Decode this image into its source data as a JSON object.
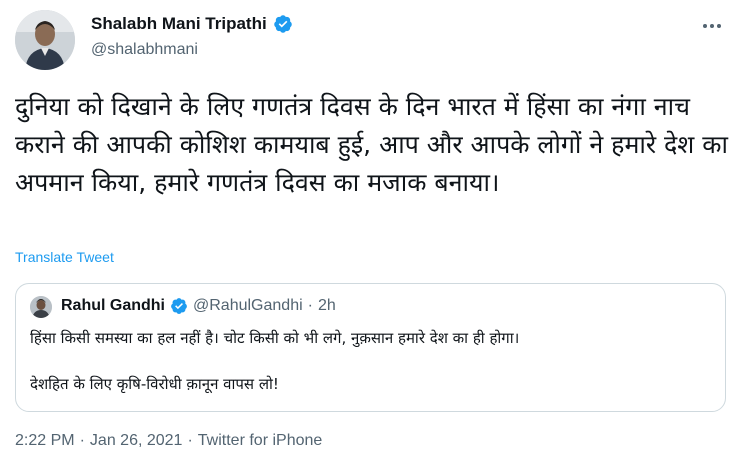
{
  "author": {
    "name": "Shalabh Mani Tripathi",
    "handle": "@shalabhmani",
    "verified": true
  },
  "tweet": {
    "text": "दुनिया को दिखाने के लिए गणतंत्र दिवस के दिन भारत में हिंसा का नंगा नाच कराने की आपकी कोशिश कामयाब हुई, आप और आपके लोगों ने हमारे देश का अपमान किया, हमारे गणतंत्र दिवस का मजाक बनाया।",
    "translate_label": "Translate Tweet"
  },
  "quoted_tweet": {
    "name": "Rahul Gandhi",
    "handle": "@RahulGandhi",
    "separator": "·",
    "time": "2h",
    "verified": true,
    "text_line1": "हिंसा किसी समस्या का हल नहीं है। चोट किसी को भी लगे, नुक़सान हमारे देश का ही होगा।",
    "text_line2": "देशहित के लिए कृषि-विरोधी क़ानून वापस लो!"
  },
  "meta": {
    "time": "2:22 PM",
    "sep1": "·",
    "date": "Jan 26, 2021",
    "sep2": "·",
    "source": "Twitter for iPhone"
  },
  "colors": {
    "accent": "#1d9bf0",
    "secondary_text": "#536471",
    "border": "#cfd9de"
  },
  "icons": {
    "verified": "verified-badge-icon",
    "more": "more-options-icon"
  }
}
